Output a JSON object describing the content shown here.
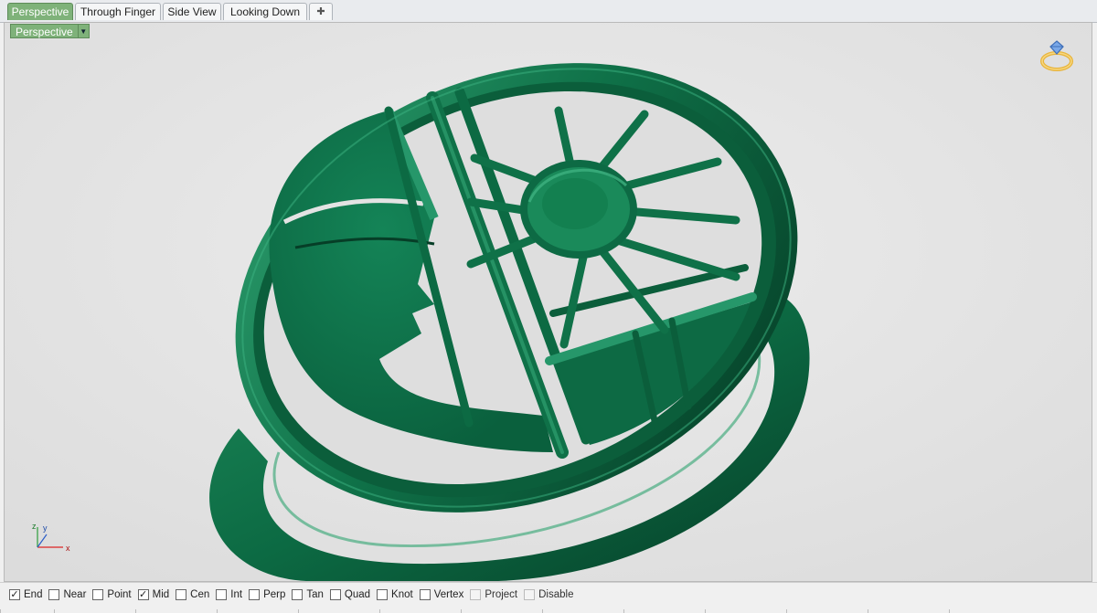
{
  "tabs": [
    {
      "label": "Perspective",
      "active": true
    },
    {
      "label": "Through Finger",
      "active": false
    },
    {
      "label": "Side View",
      "active": false
    },
    {
      "label": "Looking Down",
      "active": false
    }
  ],
  "add_tab_icon": "plus-icon",
  "viewport": {
    "label": "Perspective",
    "menu_icon": "chevron-down-icon",
    "model_color": "#0f6b45",
    "background": "#e3e3e3"
  },
  "axes": {
    "z": "z",
    "y": "y",
    "x": "x"
  },
  "osnaps": [
    {
      "label": "End",
      "checked": true
    },
    {
      "label": "Near",
      "checked": false
    },
    {
      "label": "Point",
      "checked": false
    },
    {
      "label": "Mid",
      "checked": true
    },
    {
      "label": "Cen",
      "checked": false
    },
    {
      "label": "Int",
      "checked": false
    },
    {
      "label": "Perp",
      "checked": false
    },
    {
      "label": "Tan",
      "checked": false
    },
    {
      "label": "Quad",
      "checked": false
    },
    {
      "label": "Knot",
      "checked": false
    },
    {
      "label": "Vertex",
      "checked": false
    },
    {
      "label": "Project",
      "checked": false,
      "disabled": true
    },
    {
      "label": "Disable",
      "checked": false,
      "disabled": true
    }
  ],
  "accent_color": "#7fb27a"
}
